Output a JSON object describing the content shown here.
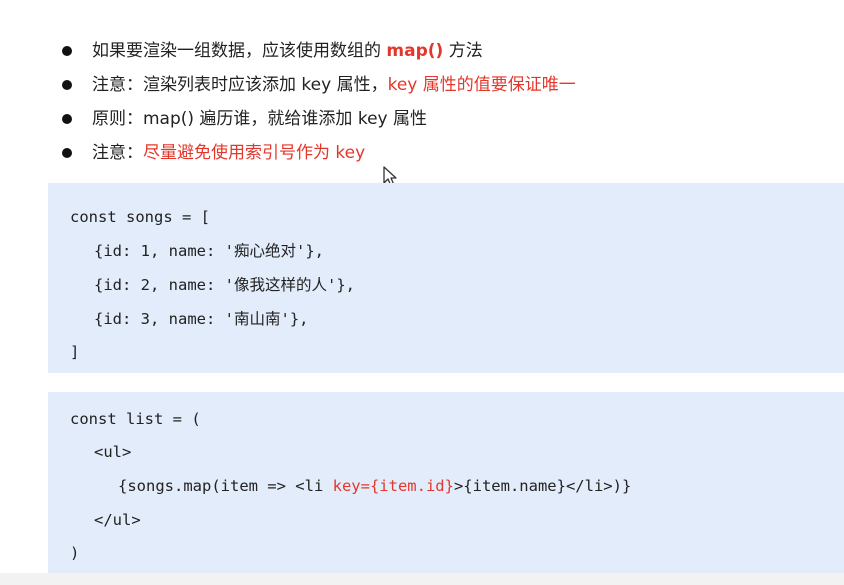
{
  "bullets": [
    {
      "parts": [
        {
          "text": "如果要渲染一组数据，应该使用数组的 ",
          "style": "normal"
        },
        {
          "text": "map()",
          "style": "red-bold"
        },
        {
          "text": " 方法",
          "style": "normal"
        }
      ]
    },
    {
      "parts": [
        {
          "text": "注意：渲染列表时应该添加 key 属性，",
          "style": "normal"
        },
        {
          "text": "key 属性的值要保证唯一",
          "style": "red"
        }
      ]
    },
    {
      "parts": [
        {
          "text": "原则：map() 遍历谁，就给谁添加 key 属性",
          "style": "normal"
        }
      ]
    },
    {
      "parts": [
        {
          "text": "注意：",
          "style": "normal"
        },
        {
          "text": "尽量避免使用索引号作为 key",
          "style": "red"
        }
      ]
    }
  ],
  "code_block_1": {
    "line1": "const songs = [",
    "line2": {
      "pre": "{id: 1, name: '",
      "str": "痴心绝对",
      "post": "'},"
    },
    "line3": {
      "pre": "{id: 2, name: '",
      "str": "像我这样的人",
      "post": "'},"
    },
    "line4": {
      "pre": "{id: 3, name: '",
      "str": "南山南",
      "post": "'},"
    },
    "line5": "]"
  },
  "code_block_2": {
    "line1": "const list = (",
    "line2": "<ul>",
    "line3": {
      "pre": "{songs.map(item => <li ",
      "key": "key={item.id}",
      "post": ">{item.name}</li>)}"
    },
    "line4": "</ul>",
    "line5": ")"
  },
  "colors": {
    "accent_red": "#e4372b",
    "code_bg": "#e3ecfb",
    "text": "#222222"
  },
  "icons": {
    "cursor": "mouse-pointer-icon"
  }
}
